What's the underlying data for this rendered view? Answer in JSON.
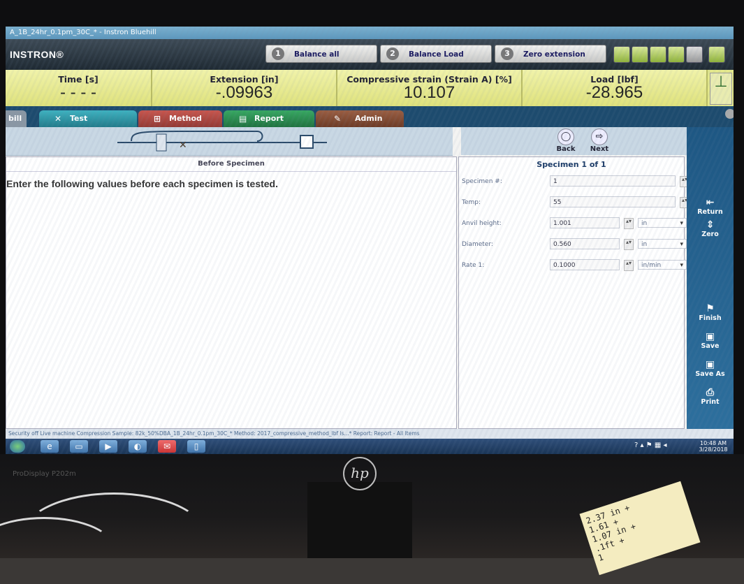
{
  "window": {
    "title": "A_1B_24hr_0.1pm_30C_* - Instron Bluehill",
    "brand": "INSTRON®"
  },
  "toolbar": {
    "steps": [
      {
        "num": "1",
        "label": "Balance all"
      },
      {
        "num": "2",
        "label": "Balance Load"
      },
      {
        "num": "3",
        "label": "Zero extension"
      }
    ]
  },
  "live_display": [
    {
      "label": "Time [s]",
      "value": "- - - -"
    },
    {
      "label": "Extension [in]",
      "value": "-.09963"
    },
    {
      "label": "Compressive strain (Strain A) [%]",
      "value": "10.107"
    },
    {
      "label": "Load [lbf]",
      "value": "-28.965"
    }
  ],
  "tabs": [
    {
      "label": "bill"
    },
    {
      "label": "Test"
    },
    {
      "label": "Method"
    },
    {
      "label": "Report"
    },
    {
      "label": "Admin"
    }
  ],
  "nav": {
    "back": "Back",
    "next": "Next"
  },
  "before": {
    "header": "Before Specimen",
    "instruction": "Enter the following values before each specimen is tested."
  },
  "specimen": {
    "header": "Specimen 1 of 1",
    "fields": [
      {
        "label": "Specimen #:",
        "value": "1",
        "unit": ""
      },
      {
        "label": "Temp:",
        "value": "55",
        "unit": ""
      },
      {
        "label": "Anvil height:",
        "value": "1.001",
        "unit": "in"
      },
      {
        "label": "Diameter:",
        "value": "0.560",
        "unit": "in"
      },
      {
        "label": "Rate 1:",
        "value": "0.1000",
        "unit": "in/min"
      }
    ]
  },
  "sidebar": {
    "items": [
      "Return",
      "Zero",
      "Finish",
      "Save",
      "Save As",
      "Print"
    ]
  },
  "status_bar": "Security off   Live machine   Compression   Sample: 82k_50%DBA_1B_24hr_0.1pm_30C_*   Method: 2017_compressive_method_lbf ls...*   Report: Report - All Items",
  "clock": {
    "time": "10:48 AM",
    "date": "3/28/2018"
  },
  "monitor": {
    "model": "ProDisplay P202m",
    "logo": "hp"
  },
  "sticky_note": "2.37 in +\n1.61 +\n1.07 in +\n.1ft +\n1"
}
